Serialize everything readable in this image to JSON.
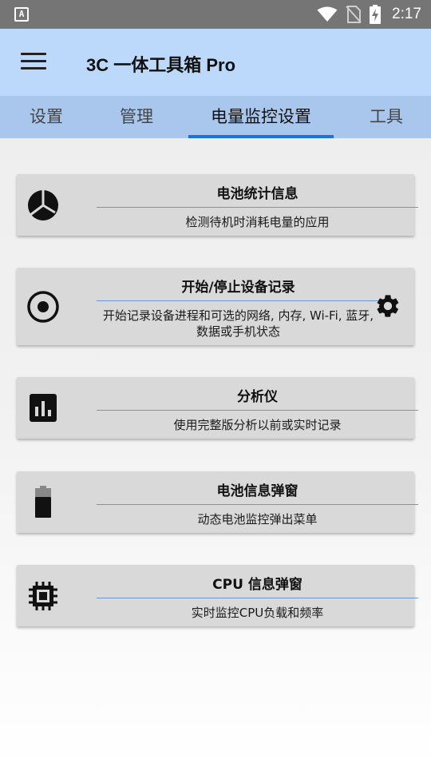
{
  "status_bar": {
    "notification_icon": "a-notification-icon",
    "time": "2:17",
    "icons": [
      "wifi-icon",
      "no-sim-icon",
      "battery-charging-icon"
    ]
  },
  "app_bar": {
    "title": "3C 一体工具箱 Pro",
    "menu_icon": "hamburger-menu-icon"
  },
  "tabs": [
    {
      "label": "设置",
      "active": false
    },
    {
      "label": "管理",
      "active": false
    },
    {
      "label": "电量监控设置",
      "active": true
    },
    {
      "label": "工具",
      "active": false
    }
  ],
  "accent_color": "#1e6fe0",
  "cards": [
    {
      "title": "电池统计信息",
      "description": "检测待机时消耗电量的应用",
      "icon": "pie-chart-icon"
    },
    {
      "title": "开始/停止设备记录",
      "description": "开始记录设备进程和可选的网络, 内存, Wi-Fi, 蓝牙, 数据或手机状态",
      "icon": "record-icon",
      "action_icon": "gear-icon"
    },
    {
      "title": "分析仪",
      "description": "使用完整版分析以前或实时记录",
      "icon": "bar-chart-icon"
    },
    {
      "title": "电池信息弹窗",
      "description": "动态电池监控弹出菜单",
      "icon": "battery-icon"
    },
    {
      "title": "CPU 信息弹窗",
      "description": "实时监控CPU负载和频率",
      "icon": "cpu-chip-icon"
    }
  ]
}
